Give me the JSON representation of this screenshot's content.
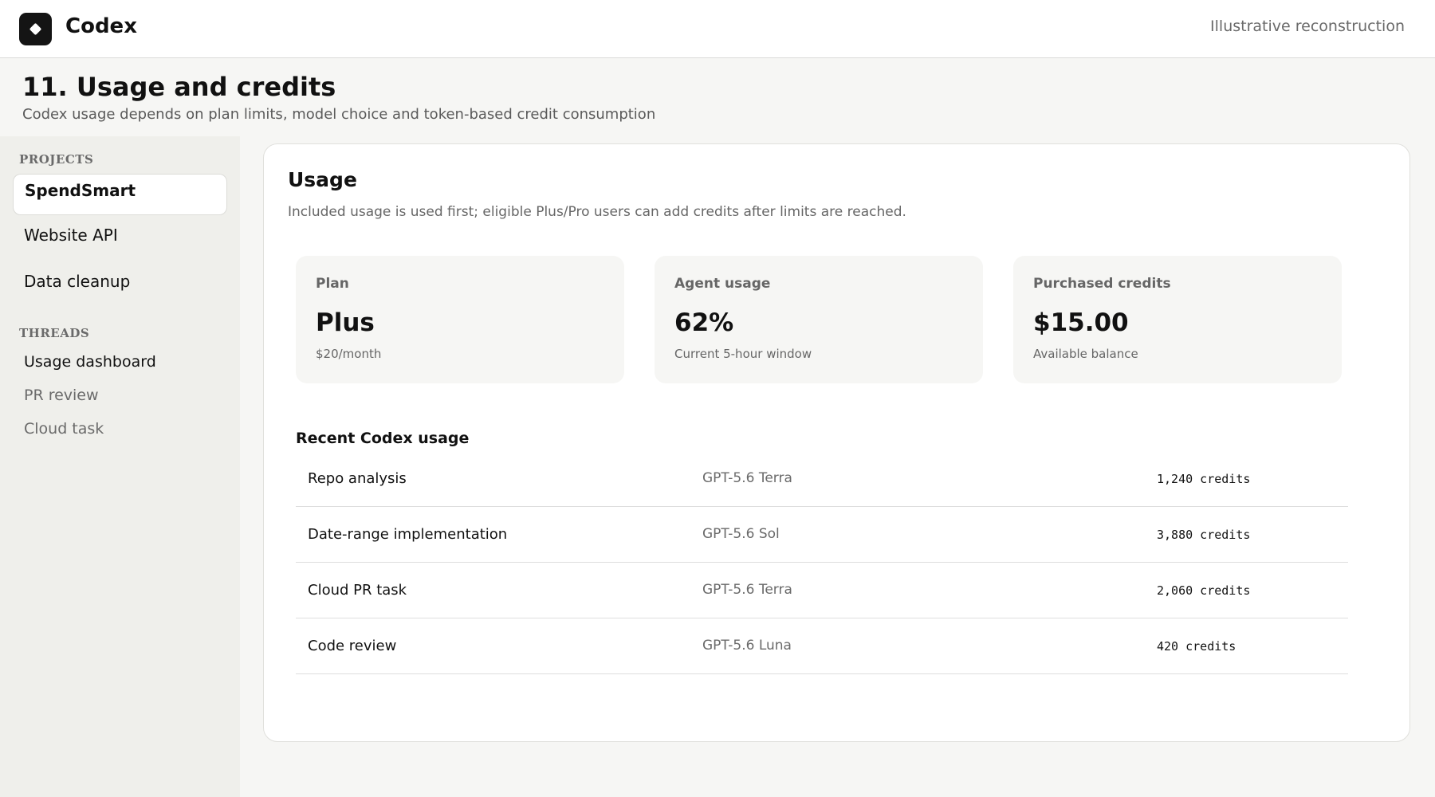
{
  "app": {
    "name": "Codex",
    "top_note": "Illustrative reconstruction",
    "logo_icon": "codex-diamond-icon"
  },
  "page": {
    "title": "11. Usage and credits",
    "subtitle": "Codex usage depends on plan limits, model choice and token-based credit consumption"
  },
  "sidebar": {
    "projects_heading": "PROJECTS",
    "projects": [
      {
        "label": "SpendSmart",
        "active": true
      },
      {
        "label": "Website API",
        "active": false
      },
      {
        "label": "Data cleanup",
        "active": false
      }
    ],
    "threads_heading": "THREADS",
    "threads": [
      {
        "label": "Usage dashboard",
        "color": "#111111"
      },
      {
        "label": "PR review",
        "color": "#6a6a6a"
      },
      {
        "label": "Cloud task",
        "color": "#6a6a6a"
      }
    ]
  },
  "usage": {
    "title": "Usage",
    "description": "Included usage is used first; eligible Plus/Pro users can add credits after limits are reached.",
    "cards": [
      {
        "label": "Plan",
        "value": "Plus",
        "note": "$20/month"
      },
      {
        "label": "Agent usage",
        "value": "62%",
        "note": "Current 5-hour window"
      },
      {
        "label": "Purchased credits",
        "value": "$15.00",
        "note": "Available balance"
      }
    ],
    "recent_title": "Recent Codex usage",
    "rows": [
      {
        "task": "Repo analysis",
        "model": "GPT-5.6 Terra",
        "credits": "1,240 credits"
      },
      {
        "task": "Date-range implementation",
        "model": "GPT-5.6 Sol",
        "credits": "3,880 credits"
      },
      {
        "task": "Cloud PR task",
        "model": "GPT-5.6 Terra",
        "credits": "2,060 credits"
      },
      {
        "task": "Code review",
        "model": "GPT-5.6 Luna",
        "credits": "420 credits"
      }
    ]
  }
}
